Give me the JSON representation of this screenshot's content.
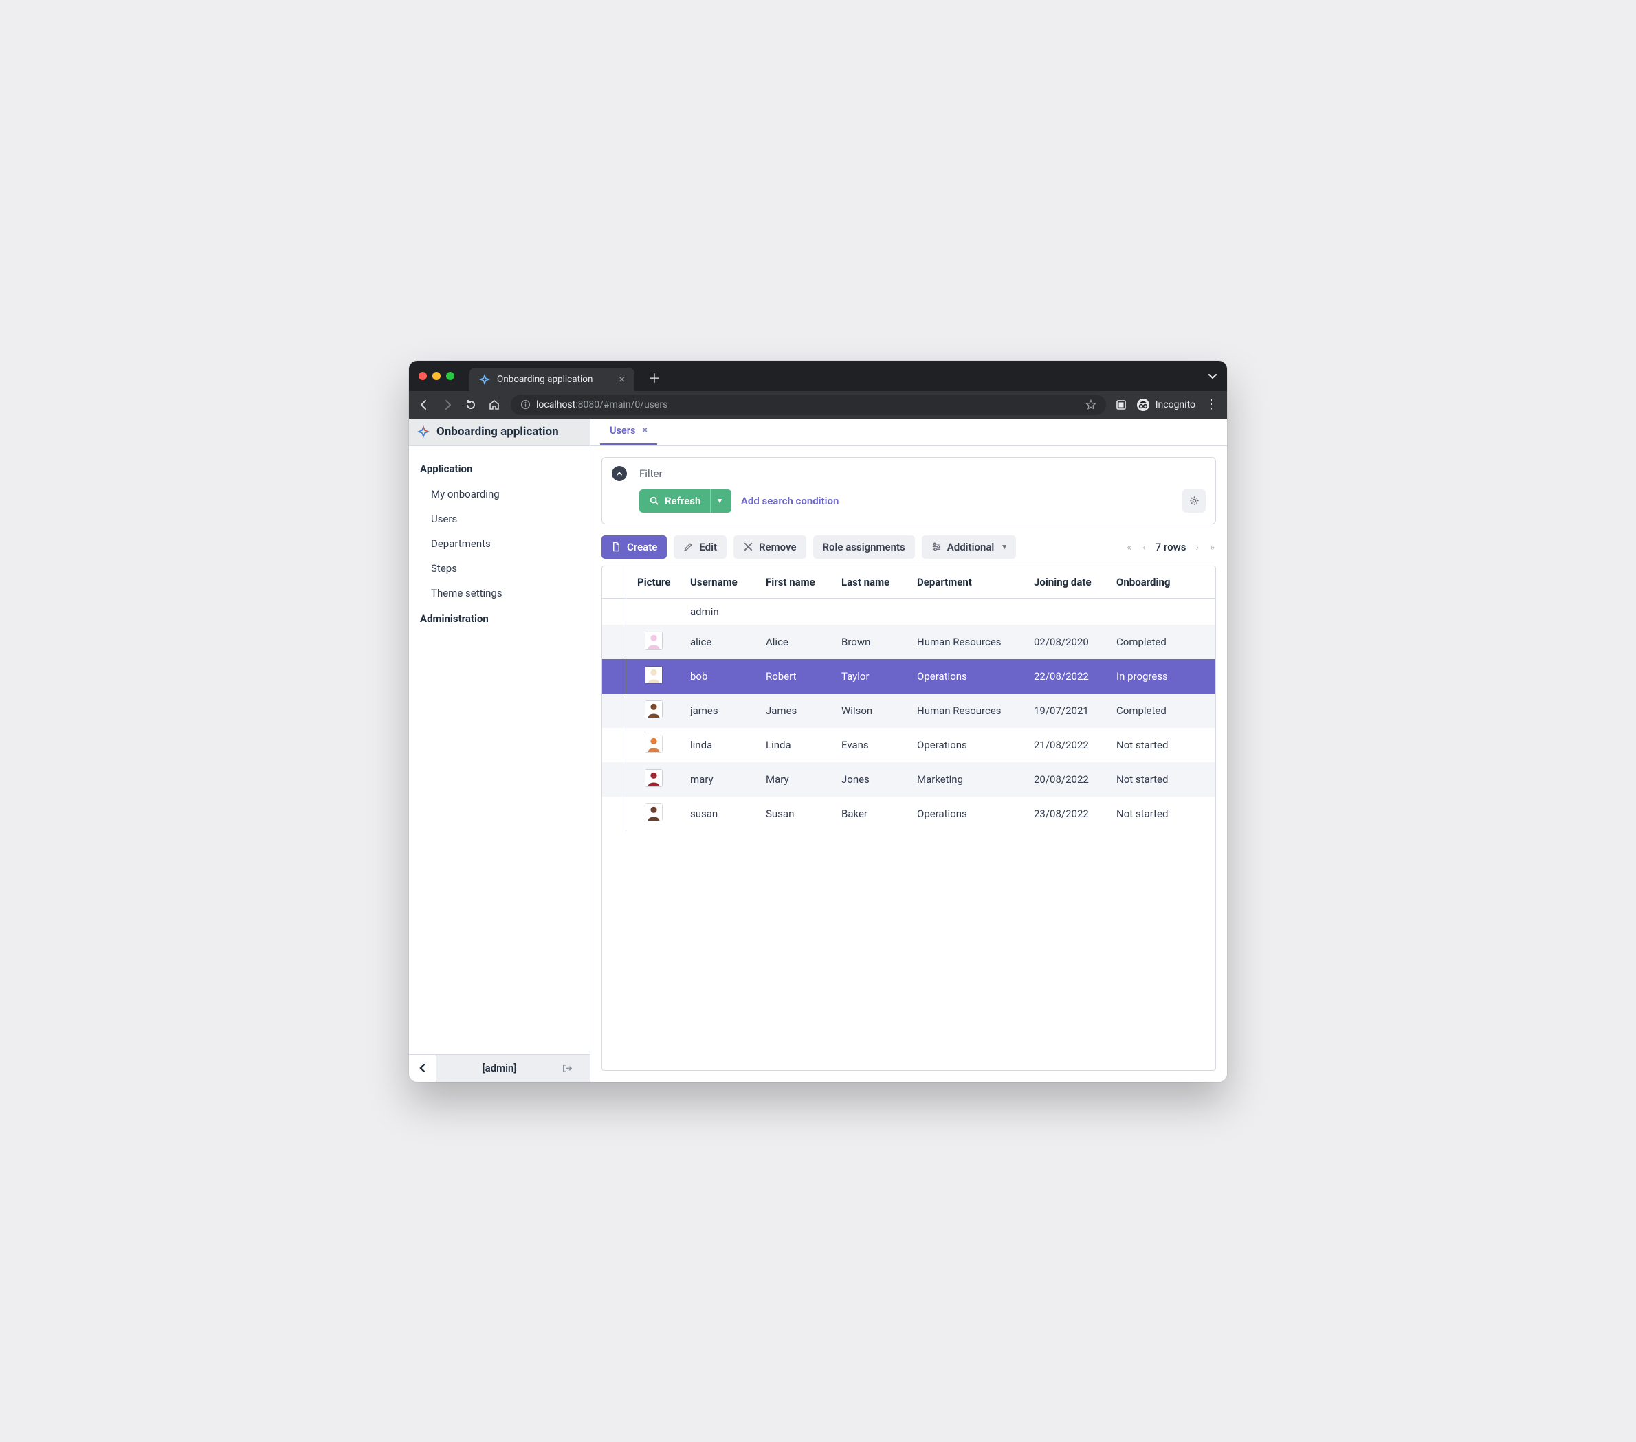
{
  "browser": {
    "tab_title": "Onboarding application",
    "url_host_prefix": "localhost",
    "url_port_path": ":8080/#main/0/users",
    "incognito_label": "Incognito"
  },
  "app": {
    "title": "Onboarding application",
    "footer_user": "[admin]"
  },
  "sidebar": {
    "groups": [
      {
        "label": "Application",
        "items": [
          "My onboarding",
          "Users",
          "Departments",
          "Steps",
          "Theme settings"
        ]
      },
      {
        "label": "Administration",
        "items": []
      }
    ]
  },
  "tabs": {
    "active": "Users"
  },
  "filter": {
    "title": "Filter",
    "refresh_label": "Refresh",
    "add_condition_label": "Add search condition"
  },
  "toolbar": {
    "create": "Create",
    "edit": "Edit",
    "remove": "Remove",
    "role_assignments": "Role assignments",
    "additional": "Additional"
  },
  "pager": {
    "rows_label": "7 rows"
  },
  "table": {
    "columns": [
      "Picture",
      "Username",
      "First name",
      "Last name",
      "Department",
      "Joining date",
      "Onboarding"
    ],
    "rows": [
      {
        "avatar": "",
        "username": "admin",
        "first": "",
        "last": "",
        "dept": "",
        "join": "",
        "onb": "",
        "selected": false
      },
      {
        "avatar": "#f1c7e6",
        "username": "alice",
        "first": "Alice",
        "last": "Brown",
        "dept": "Human Resources",
        "join": "02/08/2020",
        "onb": "Completed",
        "selected": false
      },
      {
        "avatar": "#f2e3c9",
        "username": "bob",
        "first": "Robert",
        "last": "Taylor",
        "dept": "Operations",
        "join": "22/08/2022",
        "onb": "In progress",
        "selected": true
      },
      {
        "avatar": "#7a4a2a",
        "username": "james",
        "first": "James",
        "last": "Wilson",
        "dept": "Human Resources",
        "join": "19/07/2021",
        "onb": "Completed",
        "selected": false
      },
      {
        "avatar": "#e07e3a",
        "username": "linda",
        "first": "Linda",
        "last": "Evans",
        "dept": "Operations",
        "join": "21/08/2022",
        "onb": "Not started",
        "selected": false
      },
      {
        "avatar": "#9d2432",
        "username": "mary",
        "first": "Mary",
        "last": "Jones",
        "dept": "Marketing",
        "join": "20/08/2022",
        "onb": "Not started",
        "selected": false
      },
      {
        "avatar": "#6a3f2f",
        "username": "susan",
        "first": "Susan",
        "last": "Baker",
        "dept": "Operations",
        "join": "23/08/2022",
        "onb": "Not started",
        "selected": false
      }
    ]
  }
}
